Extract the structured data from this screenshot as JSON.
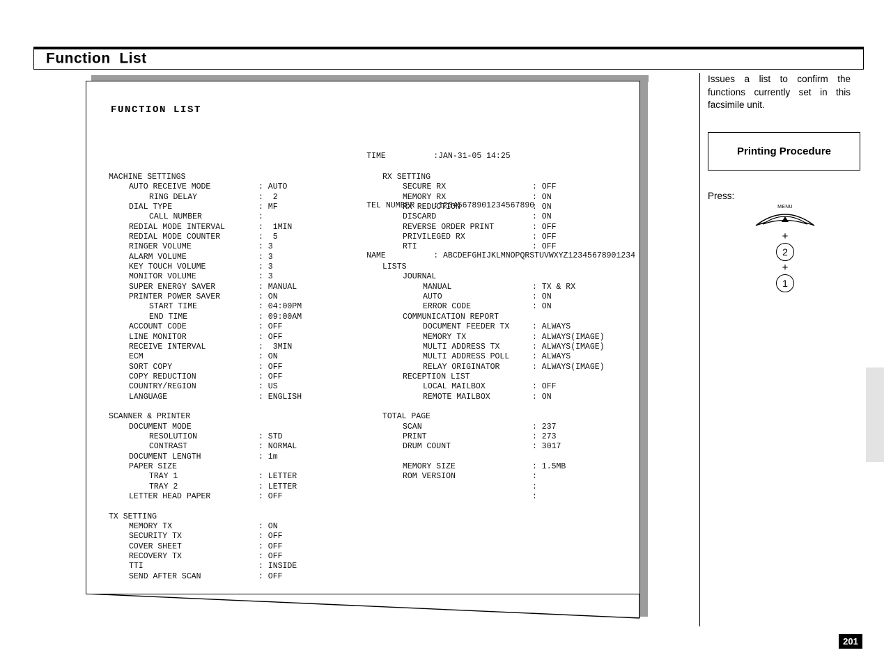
{
  "page": {
    "title": "Function  List",
    "page_number": "201"
  },
  "report": {
    "heading": "FUNCTION LIST",
    "header_rows": [
      {
        "key": "TIME",
        "value": ":JAN-31-05 14:25"
      },
      {
        "key": "TEL NUMBER",
        "value": ":12345678901234567890"
      },
      {
        "key": "NAME",
        "value": ": ABCDEFGHIJKLMNOPQRSTUVWXYZ12345678901234"
      }
    ],
    "left_column": [
      {
        "level": 0,
        "label": "MACHINE SETTINGS",
        "value": ""
      },
      {
        "level": 1,
        "label": "AUTO RECEIVE MODE",
        "value": ": AUTO"
      },
      {
        "level": 2,
        "label": "RING DELAY",
        "value": ":  2"
      },
      {
        "level": 1,
        "label": "DIAL TYPE",
        "value": ": MF"
      },
      {
        "level": 2,
        "label": "CALL NUMBER",
        "value": ":"
      },
      {
        "level": 1,
        "label": "REDIAL MODE INTERVAL",
        "value": ":  1MIN"
      },
      {
        "level": 1,
        "label": "REDIAL MODE COUNTER",
        "value": ":  5"
      },
      {
        "level": 1,
        "label": "RINGER VOLUME",
        "value": ": 3"
      },
      {
        "level": 1,
        "label": "ALARM VOLUME",
        "value": ": 3"
      },
      {
        "level": 1,
        "label": "KEY TOUCH VOLUME",
        "value": ": 3"
      },
      {
        "level": 1,
        "label": "MONITOR VOLUME",
        "value": ": 3"
      },
      {
        "level": 1,
        "label": "SUPER ENERGY SAVER",
        "value": ": MANUAL"
      },
      {
        "level": 1,
        "label": "PRINTER POWER SAVER",
        "value": ": ON"
      },
      {
        "level": 2,
        "label": "START TIME",
        "value": ": 04:00PM"
      },
      {
        "level": 2,
        "label": "END TIME",
        "value": ": 09:00AM"
      },
      {
        "level": 1,
        "label": "ACCOUNT CODE",
        "value": ": OFF"
      },
      {
        "level": 1,
        "label": "LINE MONITOR",
        "value": ": OFF"
      },
      {
        "level": 1,
        "label": "RECEIVE INTERVAL",
        "value": ":  3MIN"
      },
      {
        "level": 1,
        "label": "ECM",
        "value": ": ON"
      },
      {
        "level": 1,
        "label": "SORT COPY",
        "value": ": OFF"
      },
      {
        "level": 1,
        "label": "COPY REDUCTION",
        "value": ": OFF"
      },
      {
        "level": 1,
        "label": "COUNTRY/REGION",
        "value": ": US"
      },
      {
        "level": 1,
        "label": "LANGUAGE",
        "value": ": ENGLISH"
      },
      {
        "level": -1,
        "label": "",
        "value": ""
      },
      {
        "level": 0,
        "label": "SCANNER & PRINTER",
        "value": ""
      },
      {
        "level": 1,
        "label": "DOCUMENT MODE",
        "value": ""
      },
      {
        "level": 2,
        "label": "RESOLUTION",
        "value": ": STD"
      },
      {
        "level": 2,
        "label": "CONTRAST",
        "value": ": NORMAL"
      },
      {
        "level": 1,
        "label": "DOCUMENT LENGTH",
        "value": ": 1m"
      },
      {
        "level": 1,
        "label": "PAPER SIZE",
        "value": ""
      },
      {
        "level": 2,
        "label": "TRAY 1",
        "value": ": LETTER"
      },
      {
        "level": 2,
        "label": "TRAY 2",
        "value": ": LETTER"
      },
      {
        "level": 1,
        "label": "LETTER HEAD PAPER",
        "value": ": OFF"
      },
      {
        "level": -1,
        "label": "",
        "value": ""
      },
      {
        "level": 0,
        "label": "TX SETTING",
        "value": ""
      },
      {
        "level": 1,
        "label": "MEMORY TX",
        "value": ": ON"
      },
      {
        "level": 1,
        "label": "SECURITY TX",
        "value": ": OFF"
      },
      {
        "level": 1,
        "label": "COVER SHEET",
        "value": ": OFF"
      },
      {
        "level": 1,
        "label": "RECOVERY TX",
        "value": ": OFF"
      },
      {
        "level": 1,
        "label": "TTI",
        "value": ": INSIDE"
      },
      {
        "level": 1,
        "label": "SEND AFTER SCAN",
        "value": ": OFF"
      }
    ],
    "right_column": [
      {
        "level": 0,
        "label": "RX SETTING",
        "value": ""
      },
      {
        "level": 1,
        "label": "SECURE RX",
        "value": ": OFF"
      },
      {
        "level": 1,
        "label": "MEMORY RX",
        "value": ": ON"
      },
      {
        "level": 1,
        "label": "RX REDUCTION",
        "value": ": ON"
      },
      {
        "level": 1,
        "label": "DISCARD",
        "value": ": ON"
      },
      {
        "level": 1,
        "label": "REVERSE ORDER PRINT",
        "value": ": OFF"
      },
      {
        "level": 1,
        "label": "PRIVILEGED RX",
        "value": ": OFF"
      },
      {
        "level": 1,
        "label": "RTI",
        "value": ": OFF"
      },
      {
        "level": -1,
        "label": "",
        "value": ""
      },
      {
        "level": 0,
        "label": "LISTS",
        "value": ""
      },
      {
        "level": 1,
        "label": "JOURNAL",
        "value": ""
      },
      {
        "level": 2,
        "label": "MANUAL",
        "value": ": TX & RX"
      },
      {
        "level": 2,
        "label": "AUTO",
        "value": ": ON"
      },
      {
        "level": 2,
        "label": "ERROR CODE",
        "value": ": ON"
      },
      {
        "level": 1,
        "label": "COMMUNICATION REPORT",
        "value": ""
      },
      {
        "level": 2,
        "label": "DOCUMENT FEEDER TX",
        "value": ": ALWAYS"
      },
      {
        "level": 2,
        "label": "MEMORY TX",
        "value": ": ALWAYS(IMAGE)"
      },
      {
        "level": 2,
        "label": "MULTI ADDRESS TX",
        "value": ": ALWAYS(IMAGE)"
      },
      {
        "level": 2,
        "label": "MULTI ADDRESS POLL",
        "value": ": ALWAYS"
      },
      {
        "level": 2,
        "label": "RELAY ORIGINATOR",
        "value": ": ALWAYS(IMAGE)"
      },
      {
        "level": 1,
        "label": "RECEPTION LIST",
        "value": ""
      },
      {
        "level": 2,
        "label": "LOCAL MAILBOX",
        "value": ": OFF"
      },
      {
        "level": 2,
        "label": "REMOTE MAILBOX",
        "value": ": ON"
      },
      {
        "level": -1,
        "label": "",
        "value": ""
      },
      {
        "level": 0,
        "label": "TOTAL PAGE",
        "value": ""
      },
      {
        "level": 1,
        "label": "SCAN",
        "value": ": 237"
      },
      {
        "level": 1,
        "label": "PRINT",
        "value": ": 273"
      },
      {
        "level": 1,
        "label": "DRUM COUNT",
        "value": ": 3017"
      },
      {
        "level": -1,
        "label": "",
        "value": ""
      },
      {
        "level": 1,
        "label": "MEMORY SIZE",
        "value": ": 1.5MB"
      },
      {
        "level": 1,
        "label": "ROM VERSION",
        "value": ":"
      },
      {
        "level": 1,
        "label": "",
        "value": ":"
      },
      {
        "level": 1,
        "label": "",
        "value": ":"
      }
    ]
  },
  "sidebar": {
    "description": "Issues a list to confirm the functions currently set in this facsimile  unit.",
    "procedure_box_title": "Printing Procedure",
    "press_label": "Press:",
    "keys": {
      "menu_label": "MENU",
      "plus_1": "+",
      "key_2": "2",
      "plus_2": "+",
      "key_1": "1"
    }
  }
}
